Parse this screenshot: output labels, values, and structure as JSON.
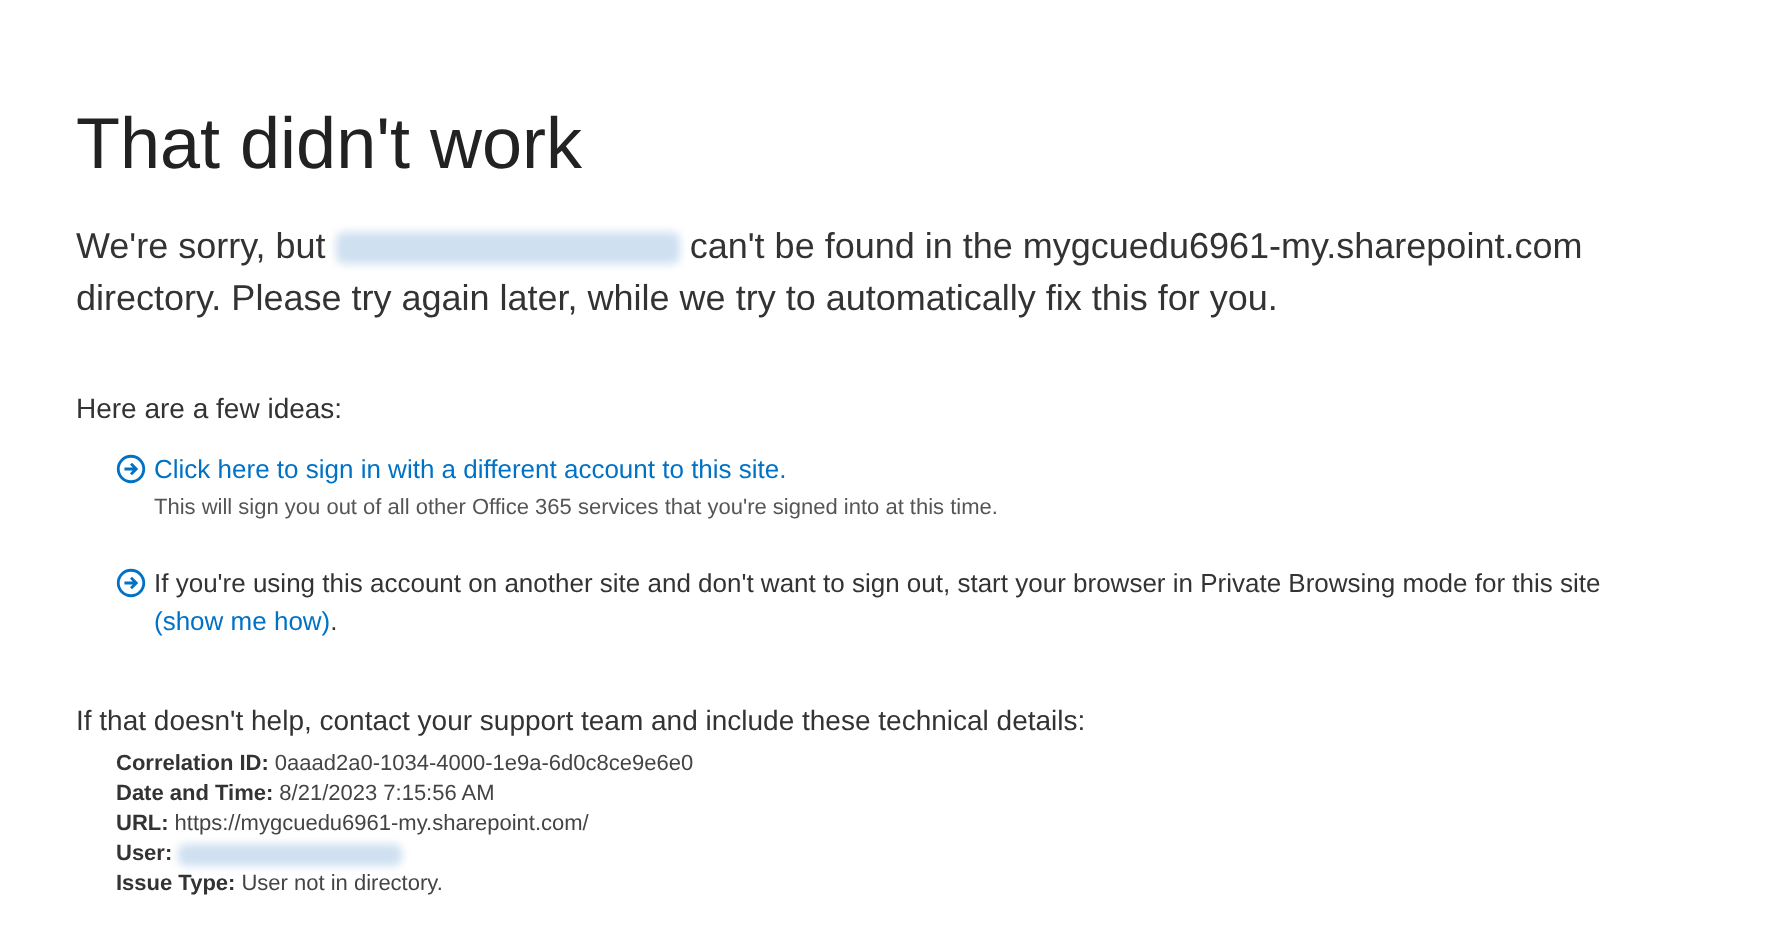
{
  "title": "That didn't work",
  "message": {
    "before": "We're sorry, but",
    "after": "can't be found in the mygcuedu6961-my.sharepoint.com directory. Please try again later, while we try to automatically fix this for you."
  },
  "ideas_heading": "Here are a few ideas:",
  "ideas": [
    {
      "kind": "link",
      "link": "Click here to sign in with a different account to this site.",
      "note": "This will sign you out of all other Office 365 services that you're signed into at this time."
    },
    {
      "kind": "text_with_link",
      "text": "If you're using this account on another site and don't want to sign out, start your browser in Private Browsing mode for this site",
      "link": "(show me how)",
      "after": "."
    }
  ],
  "help_text": "If that doesn't help, contact your support team and include these technical details:",
  "details": [
    {
      "kind": "text",
      "label": "Correlation ID:",
      "value": "0aaad2a0-1034-4000-1e9a-6d0c8ce9e6e0"
    },
    {
      "kind": "text",
      "label": "Date and Time:",
      "value": "8/21/2023 7:15:56 AM"
    },
    {
      "kind": "text",
      "label": "URL:",
      "value": "https://mygcuedu6961-my.sharepoint.com/"
    },
    {
      "kind": "redacted",
      "label": "User:"
    },
    {
      "kind": "text",
      "label": "Issue Type:",
      "value": "User not in directory."
    }
  ]
}
